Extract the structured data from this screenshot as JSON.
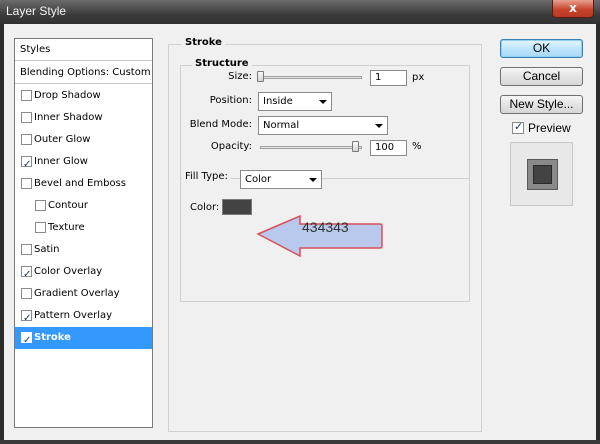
{
  "window": {
    "title": "Layer Style",
    "close_glyph": "x"
  },
  "styles_panel": {
    "header": "Styles",
    "blending": "Blending Options: Custom",
    "items": [
      {
        "label": "Drop Shadow",
        "checked": false
      },
      {
        "label": "Inner Shadow",
        "checked": false
      },
      {
        "label": "Outer Glow",
        "checked": false
      },
      {
        "label": "Inner Glow",
        "checked": true
      },
      {
        "label": "Bevel and Emboss",
        "checked": false
      },
      {
        "label": "Contour",
        "checked": false
      },
      {
        "label": "Texture",
        "checked": false
      },
      {
        "label": "Satin",
        "checked": false
      },
      {
        "label": "Color Overlay",
        "checked": true
      },
      {
        "label": "Gradient Overlay",
        "checked": false
      },
      {
        "label": "Pattern Overlay",
        "checked": true
      },
      {
        "label": "Stroke",
        "checked": true,
        "selected": true
      }
    ]
  },
  "stroke": {
    "title": "Stroke",
    "structure": {
      "title": "Structure",
      "size_label": "Size:",
      "size_value": "1",
      "size_unit": "px",
      "size_slider_fraction": 0.0,
      "position_label": "Position:",
      "position_value": "Inside",
      "blend_label": "Blend Mode:",
      "blend_value": "Normal",
      "opacity_label": "Opacity:",
      "opacity_value": "100",
      "opacity_unit": "%",
      "opacity_slider_fraction": 1.0
    },
    "fill": {
      "type_label": "Fill Type:",
      "type_value": "Color",
      "color_label": "Color:",
      "color_hex": "#434343"
    }
  },
  "buttons": {
    "ok": "OK",
    "cancel": "Cancel",
    "new_style": "New Style...",
    "preview_label": "Preview",
    "preview_checked": true
  },
  "callout": {
    "text": "434343",
    "fill": "#b9c9ee",
    "stroke": "#d8505a"
  },
  "colors": {
    "selection": "#3399ff",
    "dialog_bg": "#f0f0f0"
  }
}
